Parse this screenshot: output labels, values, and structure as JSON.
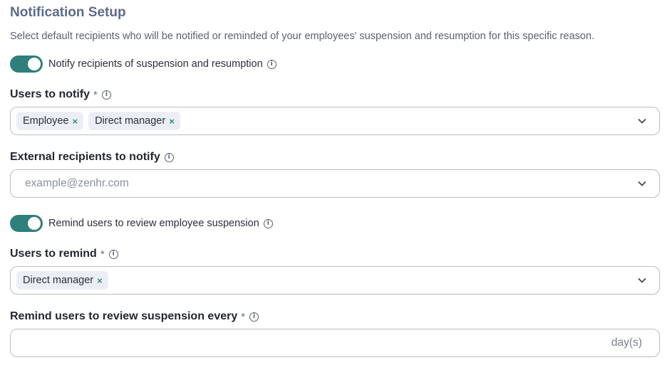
{
  "header": {
    "title": "Notification Setup",
    "description": "Select default recipients who will be notified or reminded of your employees' suspension and resumption for this specific reason."
  },
  "notify_toggle": {
    "label": "Notify recipients of suspension and resumption",
    "on": true
  },
  "users_to_notify": {
    "label": "Users to notify",
    "required_mark": "*",
    "chips": [
      "Employee",
      "Direct manager"
    ],
    "remove_glyph": "×"
  },
  "external_recipients": {
    "label": "External recipients to notify",
    "placeholder": "example@zenhr.com"
  },
  "remind_toggle": {
    "label": "Remind users to review employee suspension",
    "on": true
  },
  "users_to_remind": {
    "label": "Users to remind",
    "required_mark": "*",
    "chips": [
      "Direct manager"
    ],
    "remove_glyph": "×"
  },
  "remind_interval": {
    "label": "Remind users to review suspension every",
    "required_mark": "*",
    "value": "",
    "suffix": "day(s)"
  },
  "colors": {
    "accent": "#2f7f7b",
    "title": "#5b6b8c",
    "chip_bg": "#eceef7",
    "border": "#b8bcc4"
  },
  "icons": {
    "info": "info-circle-icon",
    "chevron": "chevron-down-icon",
    "remove": "close-icon"
  }
}
